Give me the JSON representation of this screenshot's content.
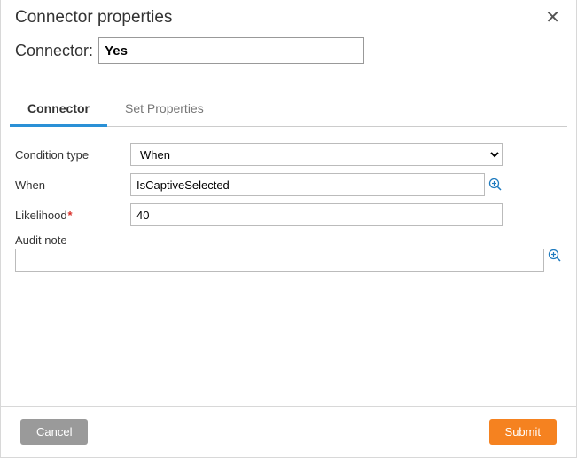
{
  "dialog": {
    "title": "Connector properties"
  },
  "connector": {
    "label": "Connector:",
    "value": "Yes"
  },
  "tabs": {
    "connector": "Connector",
    "set_properties": "Set Properties"
  },
  "form": {
    "condition_type_label": "Condition type",
    "condition_type_value": "When",
    "when_label": "When",
    "when_value": "IsCaptiveSelected",
    "likelihood_label": "Likelihood",
    "likelihood_value": "40",
    "audit_label": "Audit note",
    "audit_value": ""
  },
  "buttons": {
    "cancel": "Cancel",
    "submit": "Submit"
  }
}
